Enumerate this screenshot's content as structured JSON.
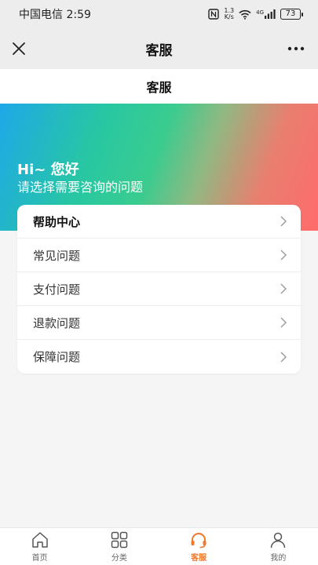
{
  "status_bar": {
    "carrier_time": "中国电信 2:59",
    "speed_value": "1.3",
    "speed_unit": "K/s",
    "network": "4G",
    "battery": "73"
  },
  "title_bar": {
    "title": "客服"
  },
  "page_header": {
    "title": "客服"
  },
  "hero": {
    "greeting": "Hi~ 您好",
    "subtitle": "请选择需要咨询的问题"
  },
  "help": {
    "items": [
      {
        "label": "帮助中心"
      },
      {
        "label": "常见问题"
      },
      {
        "label": "支付问题"
      },
      {
        "label": "退款问题"
      },
      {
        "label": "保障问题"
      }
    ]
  },
  "bottom_nav": {
    "active_color": "#f0772b",
    "items": [
      {
        "label": "首页",
        "icon": "home-icon"
      },
      {
        "label": "分类",
        "icon": "grid-icon"
      },
      {
        "label": "客服",
        "icon": "headset-icon"
      },
      {
        "label": "我的",
        "icon": "user-icon"
      }
    ]
  }
}
